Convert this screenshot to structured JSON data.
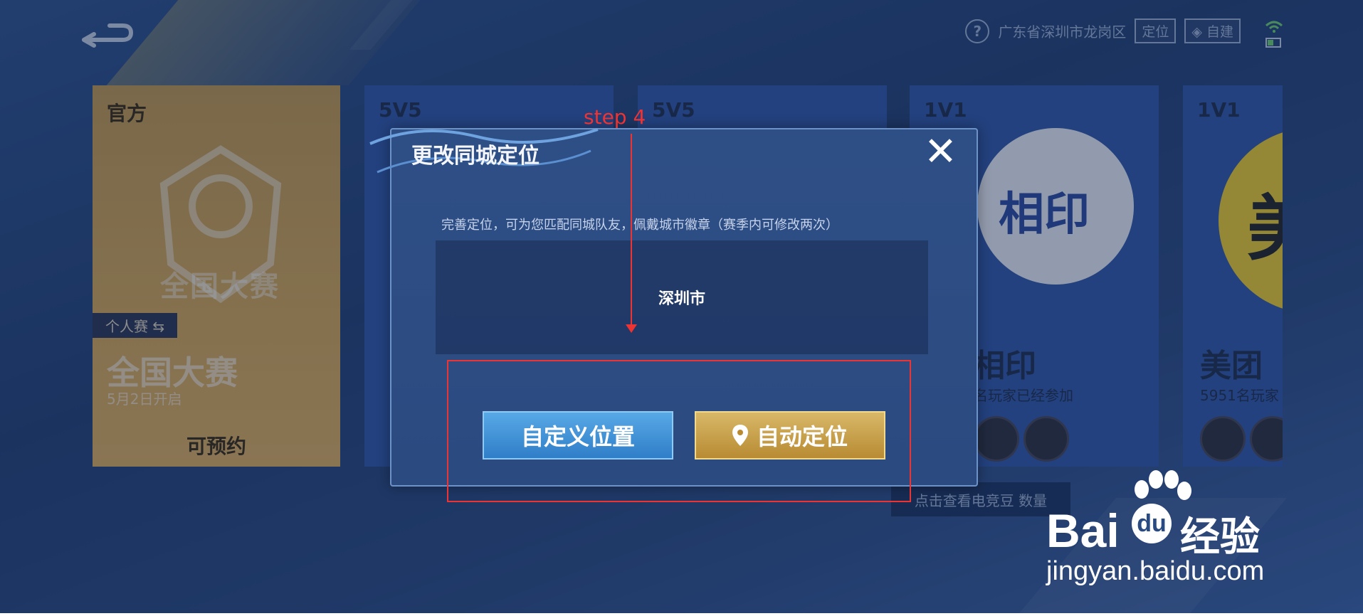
{
  "topbar": {
    "help_label": "?",
    "location_text": "广东省深圳市龙岗区",
    "locate_button": "定位",
    "build_button": "自建"
  },
  "cards": [
    {
      "mode": "官方",
      "tag": "个人赛 ⇆",
      "title": "全国大赛",
      "subtitle": "5月2日开启",
      "action": "可预约",
      "emblem_text": "全国大赛"
    },
    {
      "mode": "5V5"
    },
    {
      "mode": "5V5"
    },
    {
      "mode": "1V1",
      "brand": "相印",
      "logo_text": "相印",
      "joined": "名玩家已经参加"
    },
    {
      "mode": "1V1",
      "brand": "美团",
      "logo_text": "美",
      "joined": "5951名玩家"
    }
  ],
  "bean_link": "点击查看电竞豆 数量",
  "dialog": {
    "title": "更改同城定位",
    "description": "完善定位，可为您匹配同城队友，佩戴城市徽章（赛季内可修改两次）",
    "city": "深圳市",
    "custom_button": "自定义位置",
    "auto_button": "自动定位",
    "close_icon": "✕"
  },
  "annotation": {
    "label": "step 4",
    "color": "#e53935"
  },
  "watermark": {
    "brand": "Bai",
    "du": "du",
    "suffix": "经验",
    "url": "jingyan.baidu.com"
  },
  "colors": {
    "dialog_bg": "#2e4f86",
    "custom_button": "#3a8fd6",
    "auto_button": "#c9a24e",
    "official_card": "#d8a955"
  }
}
